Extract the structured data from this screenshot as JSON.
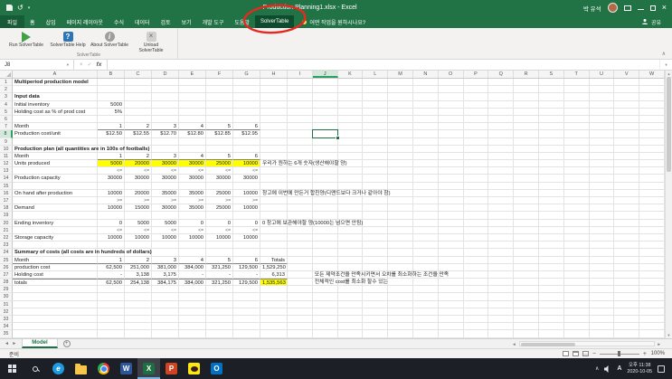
{
  "window": {
    "title": "Production Planning1.xlsx - Excel",
    "user_name": "박 유석"
  },
  "ribbon": {
    "tabs": [
      {
        "id": "file",
        "label": "파일",
        "file": true
      },
      {
        "id": "home",
        "label": "홈"
      },
      {
        "id": "insert",
        "label": "삽입"
      },
      {
        "id": "page-layout",
        "label": "페이지 레이아웃"
      },
      {
        "id": "formulas",
        "label": "수식"
      },
      {
        "id": "data",
        "label": "데이터"
      },
      {
        "id": "review",
        "label": "검토"
      },
      {
        "id": "view",
        "label": "보기"
      },
      {
        "id": "developer",
        "label": "개발 도구"
      },
      {
        "id": "help",
        "label": "도움말"
      },
      {
        "id": "solvertable",
        "label": "SolverTable",
        "active": true
      }
    ],
    "tell_me": "어떤 작업을 원하시나요?",
    "share_label": "공유",
    "group": {
      "label": "SolverTable",
      "buttons": [
        {
          "id": "run",
          "label": "Run SolverTable"
        },
        {
          "id": "help",
          "label": "SolverTable Help"
        },
        {
          "id": "about",
          "label": "About SolverTable"
        },
        {
          "id": "unload",
          "label": "Unload SolverTable"
        }
      ]
    }
  },
  "formula_bar": {
    "name_box": "J8",
    "fx_label": "fx"
  },
  "sheet": {
    "columns": [
      "A",
      "B",
      "C",
      "D",
      "E",
      "F",
      "G",
      "H",
      "I",
      "J",
      "K",
      "L",
      "M",
      "N",
      "O",
      "P",
      "Q",
      "R",
      "S",
      "T",
      "U",
      "V",
      "W"
    ],
    "row_count": 35,
    "selected": {
      "row": 8,
      "col": "J"
    },
    "highlight_color": "#ffff00",
    "cells": [
      [
        1,
        "A",
        "Multiperiod production model",
        "b note"
      ],
      [
        3,
        "A",
        "Input data",
        "b"
      ],
      [
        4,
        "A",
        "Initial inventory",
        ""
      ],
      [
        4,
        "B",
        "5000",
        "num"
      ],
      [
        5,
        "A",
        "Holding cost as % of prod cost",
        ""
      ],
      [
        5,
        "B",
        "5%",
        "num"
      ],
      [
        7,
        "A",
        "Month",
        ""
      ],
      [
        7,
        "B",
        "1",
        "num bb"
      ],
      [
        7,
        "C",
        "2",
        "num bb"
      ],
      [
        7,
        "D",
        "3",
        "num bb"
      ],
      [
        7,
        "E",
        "4",
        "num bb"
      ],
      [
        7,
        "F",
        "5",
        "num bb"
      ],
      [
        7,
        "G",
        "6",
        "num bb"
      ],
      [
        8,
        "A",
        "Production cost/unit",
        ""
      ],
      [
        8,
        "B",
        "$12.50",
        "num"
      ],
      [
        8,
        "C",
        "$12.55",
        "num"
      ],
      [
        8,
        "D",
        "$12.70",
        "num"
      ],
      [
        8,
        "E",
        "$12.80",
        "num"
      ],
      [
        8,
        "F",
        "$12.85",
        "num"
      ],
      [
        8,
        "G",
        "$12.95",
        "num"
      ],
      [
        10,
        "A",
        "Production plan (all quantities are in 100s of footballs)",
        "b note"
      ],
      [
        11,
        "A",
        "Month",
        ""
      ],
      [
        11,
        "B",
        "1",
        "num bb"
      ],
      [
        11,
        "C",
        "2",
        "num bb"
      ],
      [
        11,
        "D",
        "3",
        "num bb"
      ],
      [
        11,
        "E",
        "4",
        "num bb"
      ],
      [
        11,
        "F",
        "5",
        "num bb"
      ],
      [
        11,
        "G",
        "6",
        "num bb"
      ],
      [
        12,
        "A",
        "Units produced",
        ""
      ],
      [
        12,
        "B",
        "5000",
        "num yel"
      ],
      [
        12,
        "C",
        "20000",
        "num yel"
      ],
      [
        12,
        "D",
        "30000",
        "num yel"
      ],
      [
        12,
        "E",
        "30000",
        "num yel"
      ],
      [
        12,
        "F",
        "25000",
        "num yel"
      ],
      [
        12,
        "G",
        "10000",
        "num yel"
      ],
      [
        12,
        "H",
        "우리가 원하는 6개 숫자(생산해야할 양)",
        "note"
      ],
      [
        13,
        "B",
        "<=",
        "cmp"
      ],
      [
        13,
        "C",
        "<=",
        "cmp"
      ],
      [
        13,
        "D",
        "<=",
        "cmp"
      ],
      [
        13,
        "E",
        "<=",
        "cmp"
      ],
      [
        13,
        "F",
        "<=",
        "cmp"
      ],
      [
        13,
        "G",
        "<=",
        "cmp"
      ],
      [
        14,
        "A",
        "Production capacity",
        ""
      ],
      [
        14,
        "B",
        "30000",
        "num"
      ],
      [
        14,
        "C",
        "30000",
        "num"
      ],
      [
        14,
        "D",
        "30000",
        "num"
      ],
      [
        14,
        "E",
        "30000",
        "num"
      ],
      [
        14,
        "F",
        "30000",
        "num"
      ],
      [
        14,
        "G",
        "30000",
        "num"
      ],
      [
        16,
        "A",
        "On hand after production",
        ""
      ],
      [
        16,
        "B",
        "10000",
        "num"
      ],
      [
        16,
        "C",
        "20000",
        "num"
      ],
      [
        16,
        "D",
        "35000",
        "num"
      ],
      [
        16,
        "E",
        "35000",
        "num"
      ],
      [
        16,
        "F",
        "25000",
        "num"
      ],
      [
        16,
        "G",
        "10000",
        "num"
      ],
      [
        16,
        "H",
        "창고에 이번에 만든거 합친양(디맨드보다 크거나 같아야 함)",
        "note"
      ],
      [
        17,
        "B",
        ">=",
        "cmp"
      ],
      [
        17,
        "C",
        ">=",
        "cmp"
      ],
      [
        17,
        "D",
        ">=",
        "cmp"
      ],
      [
        17,
        "E",
        ">=",
        "cmp"
      ],
      [
        17,
        "F",
        ">=",
        "cmp"
      ],
      [
        17,
        "G",
        ">=",
        "cmp"
      ],
      [
        18,
        "A",
        "Demand",
        ""
      ],
      [
        18,
        "B",
        "10000",
        "num"
      ],
      [
        18,
        "C",
        "15000",
        "num"
      ],
      [
        18,
        "D",
        "30000",
        "num"
      ],
      [
        18,
        "E",
        "35000",
        "num"
      ],
      [
        18,
        "F",
        "25000",
        "num"
      ],
      [
        18,
        "G",
        "10000",
        "num"
      ],
      [
        20,
        "A",
        "Ending inventory",
        ""
      ],
      [
        20,
        "B",
        "0",
        "num"
      ],
      [
        20,
        "C",
        "5000",
        "num"
      ],
      [
        20,
        "D",
        "5000",
        "num"
      ],
      [
        20,
        "E",
        "0",
        "num"
      ],
      [
        20,
        "F",
        "0",
        "num"
      ],
      [
        20,
        "G",
        "0",
        "num"
      ],
      [
        20,
        "H",
        "0 창고에 보관해야할 양(10000는 넘으면 안됨)",
        "note"
      ],
      [
        21,
        "B",
        "<=",
        "cmp"
      ],
      [
        21,
        "C",
        "<=",
        "cmp"
      ],
      [
        21,
        "D",
        "<=",
        "cmp"
      ],
      [
        21,
        "E",
        "<=",
        "cmp"
      ],
      [
        21,
        "F",
        "<=",
        "cmp"
      ],
      [
        21,
        "G",
        "<=",
        "cmp"
      ],
      [
        22,
        "A",
        "Storage capacity",
        ""
      ],
      [
        22,
        "B",
        "10000",
        "num"
      ],
      [
        22,
        "C",
        "10000",
        "num"
      ],
      [
        22,
        "D",
        "10000",
        "num"
      ],
      [
        22,
        "E",
        "10000",
        "num"
      ],
      [
        22,
        "F",
        "10000",
        "num"
      ],
      [
        22,
        "G",
        "10000",
        "num"
      ],
      [
        24,
        "A",
        "Summary of costs (all costs are in hundreds of dollars)",
        "b note"
      ],
      [
        25,
        "A",
        "Month",
        "bb"
      ],
      [
        25,
        "B",
        "1",
        "num bb"
      ],
      [
        25,
        "C",
        "2",
        "num bb"
      ],
      [
        25,
        "D",
        "3",
        "num bb"
      ],
      [
        25,
        "E",
        "4",
        "num bb"
      ],
      [
        25,
        "F",
        "5",
        "num bb"
      ],
      [
        25,
        "G",
        "6",
        "num bb"
      ],
      [
        25,
        "H",
        "Totals",
        "num bb"
      ],
      [
        26,
        "A",
        "production cost",
        ""
      ],
      [
        26,
        "B",
        "62,500",
        "num"
      ],
      [
        26,
        "C",
        "251,000",
        "num"
      ],
      [
        26,
        "D",
        "381,000",
        "num"
      ],
      [
        26,
        "E",
        "384,000",
        "num"
      ],
      [
        26,
        "F",
        "321,250",
        "num"
      ],
      [
        26,
        "G",
        "129,500",
        "num"
      ],
      [
        26,
        "H",
        "1,529,250",
        "num"
      ],
      [
        27,
        "A",
        "Holding cost",
        ""
      ],
      [
        27,
        "B",
        "-",
        "num"
      ],
      [
        27,
        "C",
        "3,138",
        "num"
      ],
      [
        27,
        "D",
        "3,175",
        "num"
      ],
      [
        27,
        "E",
        "-",
        "num"
      ],
      [
        27,
        "F",
        "-",
        "num"
      ],
      [
        27,
        "G",
        "-",
        "num"
      ],
      [
        27,
        "H",
        "6,313",
        "num"
      ],
      [
        27,
        "J",
        "모든 제약조건을 만족시키면서 오차를 최소화하는 조건을 만족",
        "note"
      ],
      [
        28,
        "A",
        "totals",
        "bt"
      ],
      [
        28,
        "B",
        "62,500",
        "num bt"
      ],
      [
        28,
        "C",
        "254,138",
        "num bt"
      ],
      [
        28,
        "D",
        "384,175",
        "num bt"
      ],
      [
        28,
        "E",
        "384,000",
        "num bt"
      ],
      [
        28,
        "F",
        "321,250",
        "num bt"
      ],
      [
        28,
        "G",
        "129,500",
        "num bt"
      ],
      [
        28,
        "H",
        "1,535,563",
        "num bt yel"
      ],
      [
        28,
        "J",
        "전체적인 cost를 최소화 할수 있는",
        "note"
      ]
    ]
  },
  "sheet_tabs": {
    "active": "Model"
  },
  "status_bar": {
    "ready": "준비",
    "zoom": "100%"
  },
  "taskbar": {
    "apps": [
      {
        "id": "edge",
        "glyph": "e"
      },
      {
        "id": "folder"
      },
      {
        "id": "chrome"
      },
      {
        "id": "word",
        "glyph": "W"
      },
      {
        "id": "excel",
        "glyph": "X",
        "active": true
      },
      {
        "id": "powerpoint",
        "glyph": "P"
      },
      {
        "id": "kakao"
      },
      {
        "id": "outlook",
        "glyph": "O"
      }
    ],
    "tray": {
      "ime": "A",
      "time": "오후 11:38",
      "date": "2020-10-05"
    }
  },
  "annotation": {
    "color": "#e8281e"
  }
}
